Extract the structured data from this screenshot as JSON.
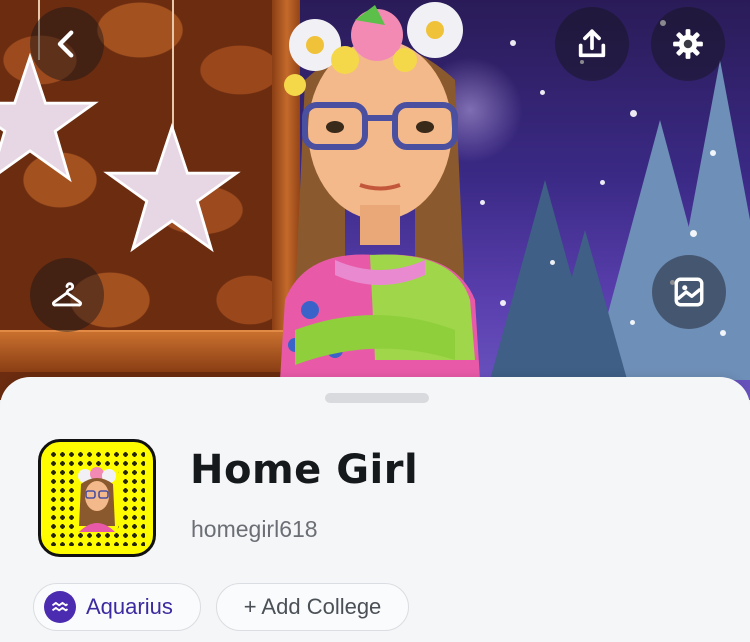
{
  "profile": {
    "display_name": "Home Girl",
    "username": "homegirl618"
  },
  "chips": {
    "zodiac": "Aquarius",
    "add_college": "+ Add College"
  },
  "icons": {
    "back": "chevron-left-icon",
    "share": "share-upload-icon",
    "settings": "gear-icon",
    "outfit": "hanger-icon",
    "background": "image-icon",
    "zodiac": "aquarius-icon"
  },
  "colors": {
    "snapcode_yellow": "#FFFC00",
    "zodiac_purple": "#4B2BB0",
    "sheet_bg": "#F5F6F8"
  }
}
